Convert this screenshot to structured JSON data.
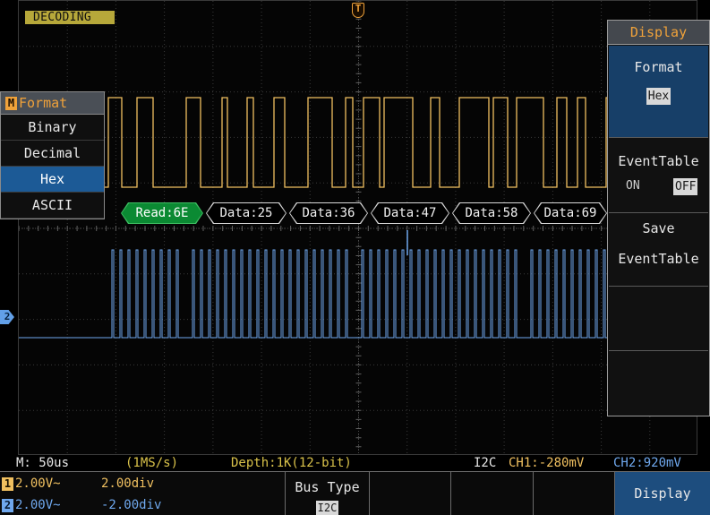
{
  "screen": {
    "mode_badge": "DECODING",
    "trigger_marker": "T",
    "ch2_marker": "2"
  },
  "decode_packets": [
    {
      "label": "Read:6E",
      "kind": "read"
    },
    {
      "label": "Data:25",
      "kind": "data"
    },
    {
      "label": "Data:36",
      "kind": "data"
    },
    {
      "label": "Data:47",
      "kind": "data"
    },
    {
      "label": "Data:58",
      "kind": "data"
    },
    {
      "label": "Data:69",
      "kind": "data"
    }
  ],
  "format_menu": {
    "key": "M",
    "title": "Format",
    "items": [
      "Binary",
      "Decimal",
      "Hex",
      "ASCII"
    ],
    "selected": "Hex"
  },
  "right_menu": {
    "title": "Display",
    "format_label": "Format",
    "format_value": "Hex",
    "event_table_label": "EventTable",
    "on_label": "ON",
    "off_label": "OFF",
    "event_table_state": "OFF",
    "save_label_1": "Save",
    "save_label_2": "EventTable"
  },
  "status": {
    "timebase": "M: 50us",
    "sample_rate": "(1MS/s)",
    "depth": "Depth:1K(12-bit)",
    "trigger_source": "I2C",
    "ch1_trig": "CH1:-280mV",
    "ch2_trig": "CH2:920mV"
  },
  "bottom_bar": {
    "ch1": {
      "num": "1",
      "volts": "2.00V~",
      "offset": "2.00div"
    },
    "ch2": {
      "num": "2",
      "volts": "2.00V~",
      "offset": "-2.00div"
    },
    "bus_type_label": "Bus Type",
    "bus_type_value": "I2C",
    "display_button": "Display"
  },
  "colors": {
    "ch1": "#f0c060",
    "ch2": "#6fa8ee",
    "accent": "#f0a23a",
    "selected": "#1c5a96"
  }
}
